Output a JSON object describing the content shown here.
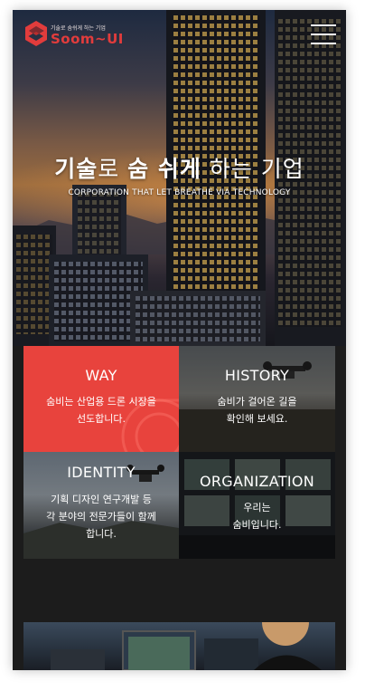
{
  "header": {
    "logo_tagline": "기술로 숨쉬게 하는 기업",
    "logo_text_main": "Soom",
    "logo_text_suffix": "UI",
    "menu_icon": "hamburger-menu-icon"
  },
  "hero": {
    "title_part1": "기술",
    "title_part2": "로 ",
    "title_part3": "숨 쉬게",
    "title_part4": " 하는 기업",
    "subtitle": "CORPORATION THAT LET BREATHE VIA TECHNOLOGY"
  },
  "tiles": [
    {
      "title": "WAY",
      "line1": "숨비는 산업용 드론 시장을",
      "line2": "선도합니다.",
      "line3": ""
    },
    {
      "title": "HISTORY",
      "line1": "숨비가 걸어온 길을",
      "line2": "확인해 보세요.",
      "line3": ""
    },
    {
      "title": "IDENTITY",
      "line1": "기획 디자인 연구개발 등",
      "line2": "각 분야의 전문가들이 함께",
      "line3": "합니다."
    },
    {
      "title": "ORGANIZATION",
      "line1": "우리는",
      "line2": "숨비입니다.",
      "line3": ""
    }
  ],
  "colors": {
    "brand_red": "#e8433d",
    "background_dark": "#1c1c1c"
  }
}
